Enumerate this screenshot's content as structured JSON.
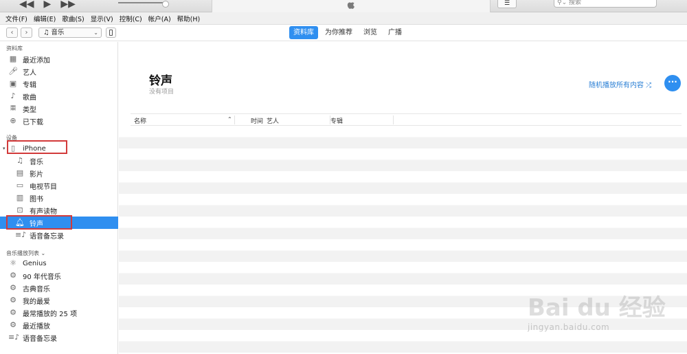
{
  "search": {
    "placeholder": "搜索"
  },
  "menu": [
    "文件(F)",
    "编辑(E)",
    "歌曲(S)",
    "显示(V)",
    "控制(C)",
    "帐户(A)",
    "帮助(H)"
  ],
  "nav": {
    "media_select": "音乐"
  },
  "tabs": [
    "资料库",
    "为你推荐",
    "浏览",
    "广播"
  ],
  "sidebar": {
    "library_header": "资料库",
    "library": [
      "最近添加",
      "艺人",
      "专辑",
      "歌曲",
      "类型",
      "已下载"
    ],
    "devices_header": "设备",
    "device_name": "iPhone",
    "device_items": [
      "音乐",
      "影片",
      "电视节目",
      "图书",
      "有声读物",
      "铃声",
      "语音备忘录"
    ],
    "playlists_header": "音乐播放列表 ⌄",
    "playlists": [
      "Genius",
      "90 年代音乐",
      "古典音乐",
      "我的最爱",
      "最常播放的 25 项",
      "最近播放",
      "语音备忘录"
    ]
  },
  "main": {
    "title": "铃声",
    "subtitle": "没有项目",
    "shuffle": "随机播放所有内容 ⤮",
    "more": "···",
    "columns": [
      "名称",
      "时间",
      "艺人",
      "专辑"
    ]
  },
  "watermark": {
    "main": "Bai du 经验",
    "sub": "jingyan.baidu.com"
  },
  "colors": {
    "accent": "#2f8ff0",
    "highlight_box": "#d23a3a"
  }
}
